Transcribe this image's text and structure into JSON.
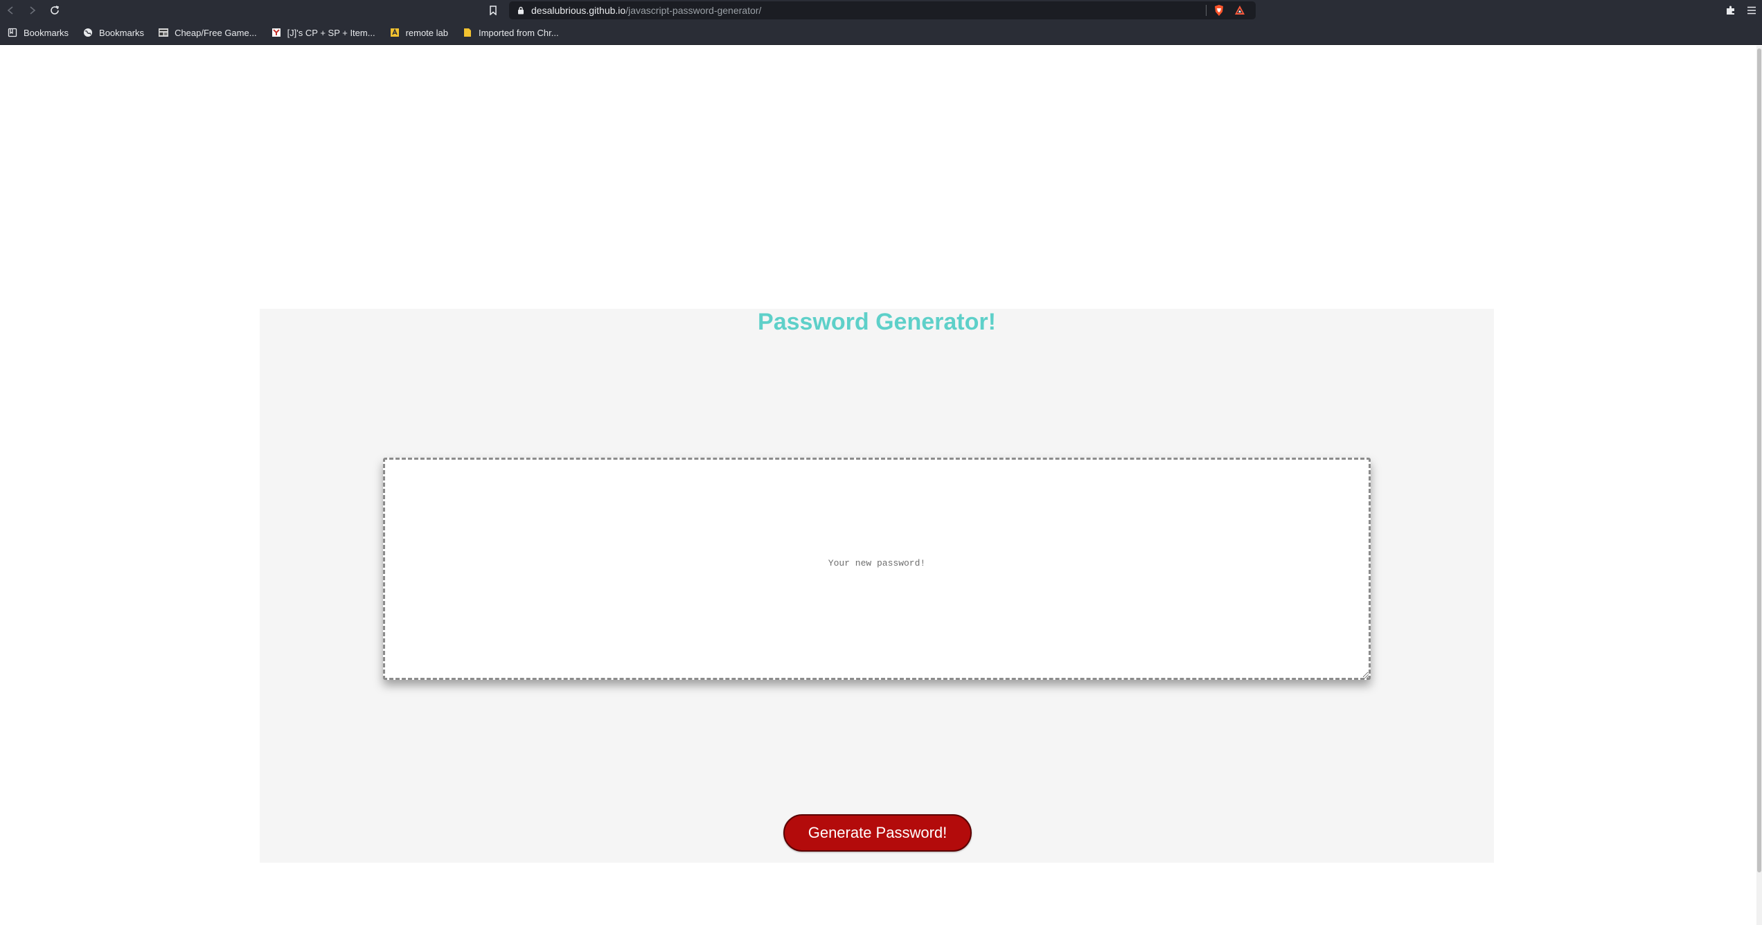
{
  "browser": {
    "url_domain": "desalubrious.github.io",
    "url_path": "/javascript-password-generator/",
    "bookmarks": [
      {
        "label": "Bookmarks",
        "icon": "bookmark-folder-icon"
      },
      {
        "label": "Bookmarks",
        "icon": "globe-icon"
      },
      {
        "label": "Cheap/Free Game...",
        "icon": "game-site-icon"
      },
      {
        "label": "[J]'s CP + SP + Item...",
        "icon": "youtube-icon"
      },
      {
        "label": "remote lab",
        "icon": "remote-lab-icon"
      },
      {
        "label": "Imported from Chr...",
        "icon": "folder-icon"
      }
    ]
  },
  "page": {
    "title": "Password Generator!",
    "password_placeholder": "Your new password!",
    "generate_button_label": "Generate Password!"
  },
  "colors": {
    "title": "#5ed0c9",
    "card_background": "#f5f5f5",
    "button_background": "#b30b0b",
    "chrome_background": "#2a2d36"
  }
}
